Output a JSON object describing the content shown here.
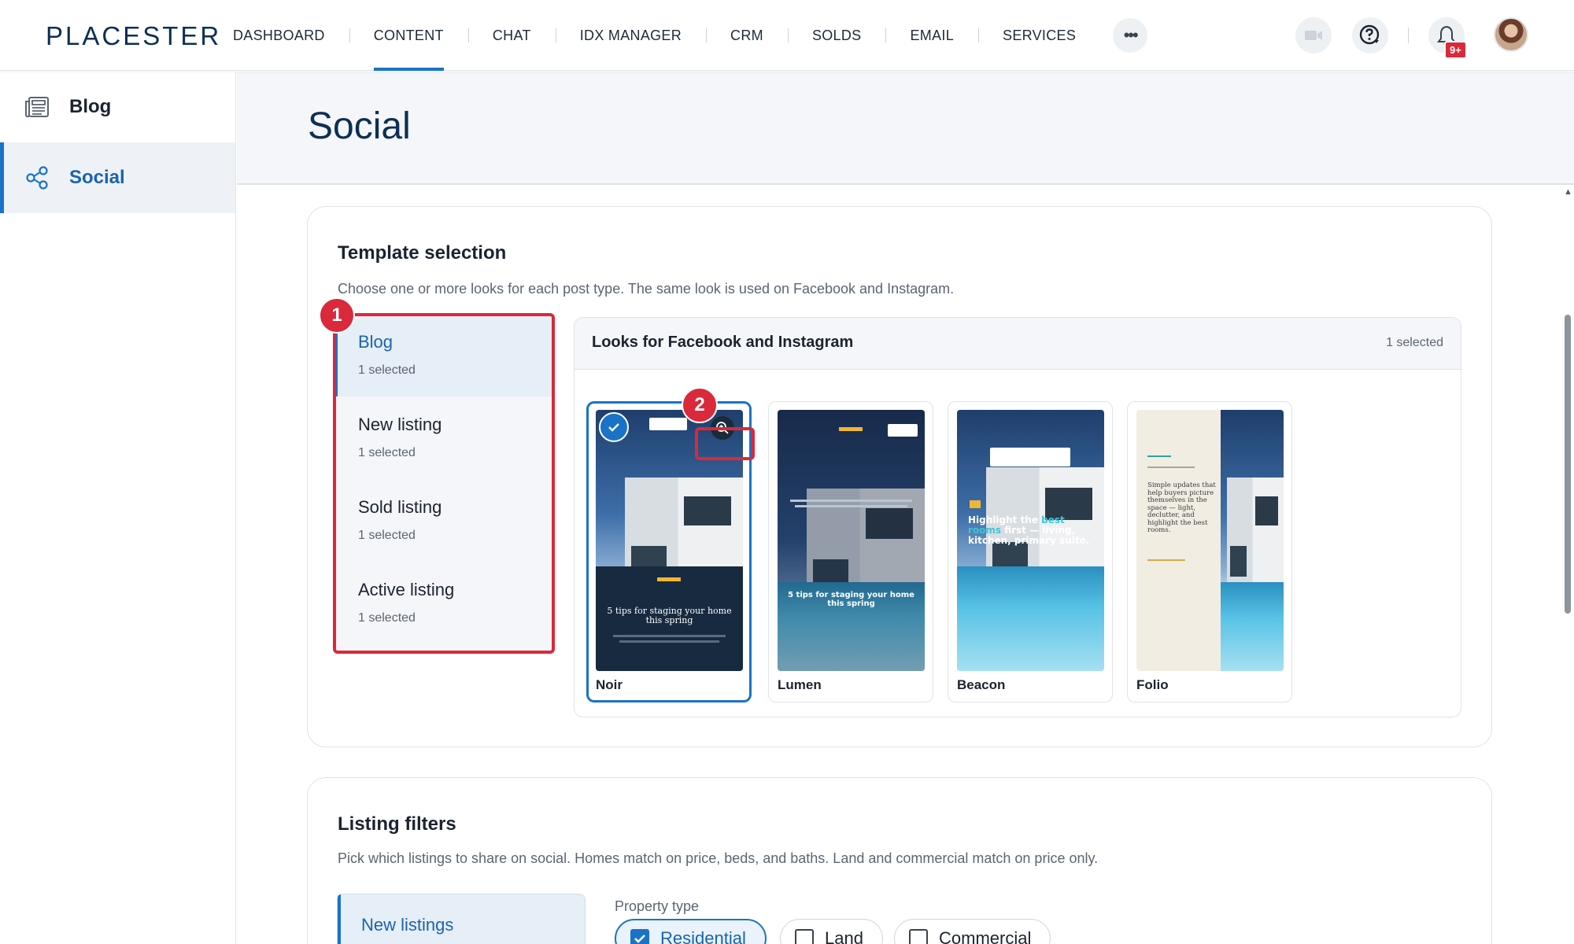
{
  "app": {
    "logo": "PLACESTER"
  },
  "nav": {
    "items": [
      {
        "label": "DASHBOARD"
      },
      {
        "label": "CONTENT"
      },
      {
        "label": "CHAT"
      },
      {
        "label": "IDX MANAGER"
      },
      {
        "label": "CRM"
      },
      {
        "label": "SOLDS"
      },
      {
        "label": "EMAIL"
      },
      {
        "label": "SERVICES"
      }
    ],
    "active": "CONTENT",
    "more_icon": "ellipsis-icon",
    "notification_badge": "9+"
  },
  "sidebar": {
    "items": [
      {
        "label": "Blog",
        "icon": "newspaper-icon"
      },
      {
        "label": "Social",
        "icon": "share-icon",
        "active": true
      }
    ]
  },
  "page": {
    "title": "Social"
  },
  "template_selection": {
    "title": "Template selection",
    "subtitle": "Choose one or more looks for each post type. The same look is used on Facebook and Instagram.",
    "post_types": [
      {
        "label": "Blog",
        "count": "1 selected",
        "active": true
      },
      {
        "label": "New listing",
        "count": "1 selected"
      },
      {
        "label": "Sold listing",
        "count": "1 selected"
      },
      {
        "label": "Active listing",
        "count": "1 selected"
      }
    ],
    "looks_panel": {
      "title": "Looks for Facebook and Instagram",
      "count": "1 selected",
      "looks": [
        {
          "name": "Noir",
          "selected": true,
          "headline": "5 tips for staging your home this spring"
        },
        {
          "name": "Lumen",
          "selected": false,
          "headline": "5 tips for staging your home this spring"
        },
        {
          "name": "Beacon",
          "selected": false,
          "headline_start": "Highlight the ",
          "headline_accent": "best rooms",
          "headline_end": " first — living, kitchen, primary suite."
        },
        {
          "name": "Folio",
          "selected": false,
          "body": "Simple updates that help buyers picture themselves in the space — light, declutter, and highlight the best rooms."
        }
      ]
    }
  },
  "annotations": [
    "1",
    "2"
  ],
  "listing_filters": {
    "title": "Listing filters",
    "subtitle": "Pick which listings to share on social. Homes match on price, beds, and baths. Land and commercial match on price only.",
    "tab": "New listings",
    "property_type_label": "Property type",
    "property_types": [
      {
        "label": "Residential",
        "checked": true
      },
      {
        "label": "Land",
        "checked": false
      },
      {
        "label": "Commercial",
        "checked": false
      }
    ]
  },
  "colors": {
    "accent": "#1a73c7",
    "brand_dark": "#0d2f55",
    "annotation": "#d9293b"
  }
}
